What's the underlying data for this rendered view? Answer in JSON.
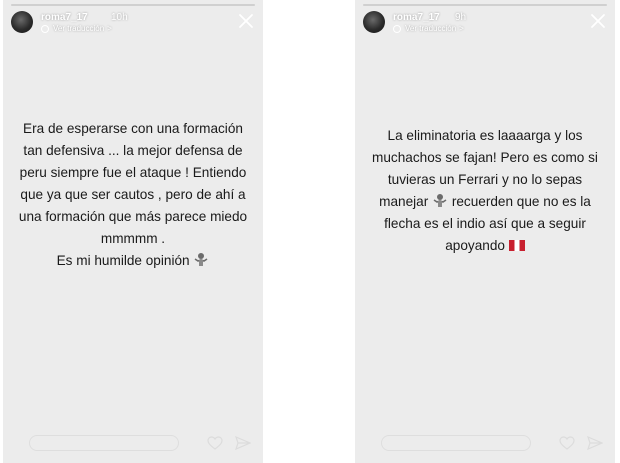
{
  "stories": [
    {
      "username": "roma7_17",
      "time": "10h",
      "translate_label": "Ver traducción",
      "chevron": ">",
      "lines": [
        "Era de esperarse con una formación",
        "tan defensiva ... la mejor defensa de",
        "peru siempre fue el ataque ! Entiendo",
        "que ya que ser cautos , pero de ahí a",
        "una formación que más parece miedo",
        "mmmmm ."
      ],
      "last_line": "Es mi humilde opinión",
      "emoji": "shrug-icon"
    },
    {
      "username": "roma7_17",
      "time": "9h",
      "translate_label": "Ver traducción",
      "chevron": ">",
      "lines": [
        "La eliminatoria es laaaarga y los",
        "muchachos se fajan! Pero es como si",
        "tuvieras un Ferrari y no lo sepas"
      ],
      "line4_before": "manejar",
      "line4_after": "recuerden que no es la",
      "line5": "flecha es el indio así que a seguir",
      "last_line": "apoyando",
      "emoji": "shrug-icon",
      "flag": "peru-flag-icon"
    }
  ],
  "colors": {
    "story_bg": "#ececec",
    "text": "#1a1a1a",
    "overlay": "#ffffff",
    "flag_red": "#c8202f"
  }
}
